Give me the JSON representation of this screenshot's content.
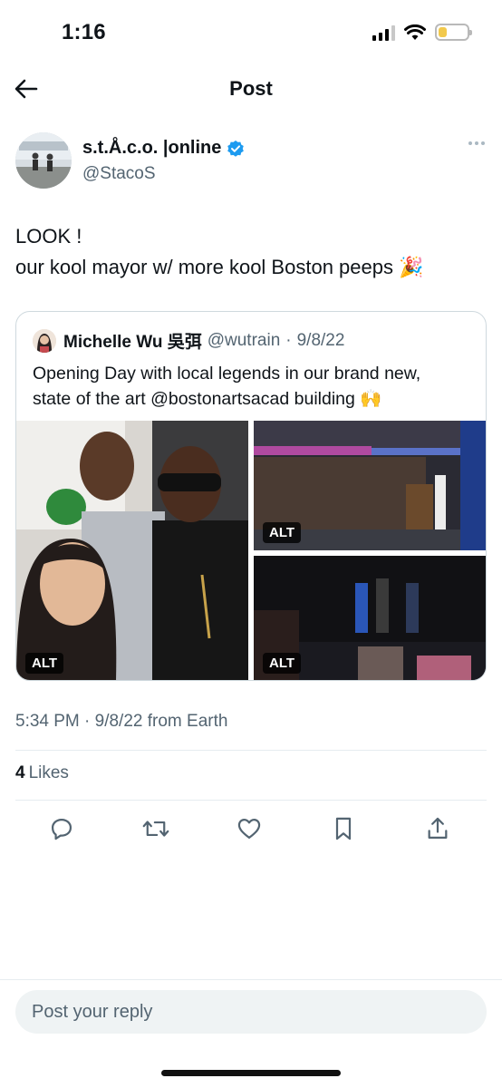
{
  "status_bar": {
    "time": "1:16"
  },
  "header": {
    "title": "Post"
  },
  "author": {
    "name": "s.t.Å.c.o. |online",
    "handle": "@StacoS",
    "verified": true
  },
  "tweet": {
    "text": "LOOK !\nour kool mayor w/ more kool Boston peeps 🎉"
  },
  "quote": {
    "name": "Michelle Wu 吳弭",
    "handle": "@wutrain",
    "separator": "·",
    "date": "9/8/22",
    "text": "Opening Day with local legends in our brand new,\nstate of the art @bostonartsacad building 🙌",
    "media_alt": [
      "ALT",
      "ALT",
      "ALT"
    ]
  },
  "meta": {
    "timestamp": "5:34 PM · 9/8/22 from Earth"
  },
  "engagement": {
    "likes_count": "4",
    "likes_label": "Likes"
  },
  "actions": [
    "reply-icon",
    "repost-icon",
    "like-icon",
    "bookmark-icon",
    "share-icon"
  ],
  "reply": {
    "placeholder": "Post your reply"
  },
  "colors": {
    "verified": "#1d9bf0",
    "secondary_text": "#536471",
    "border": "#cfd9de"
  }
}
